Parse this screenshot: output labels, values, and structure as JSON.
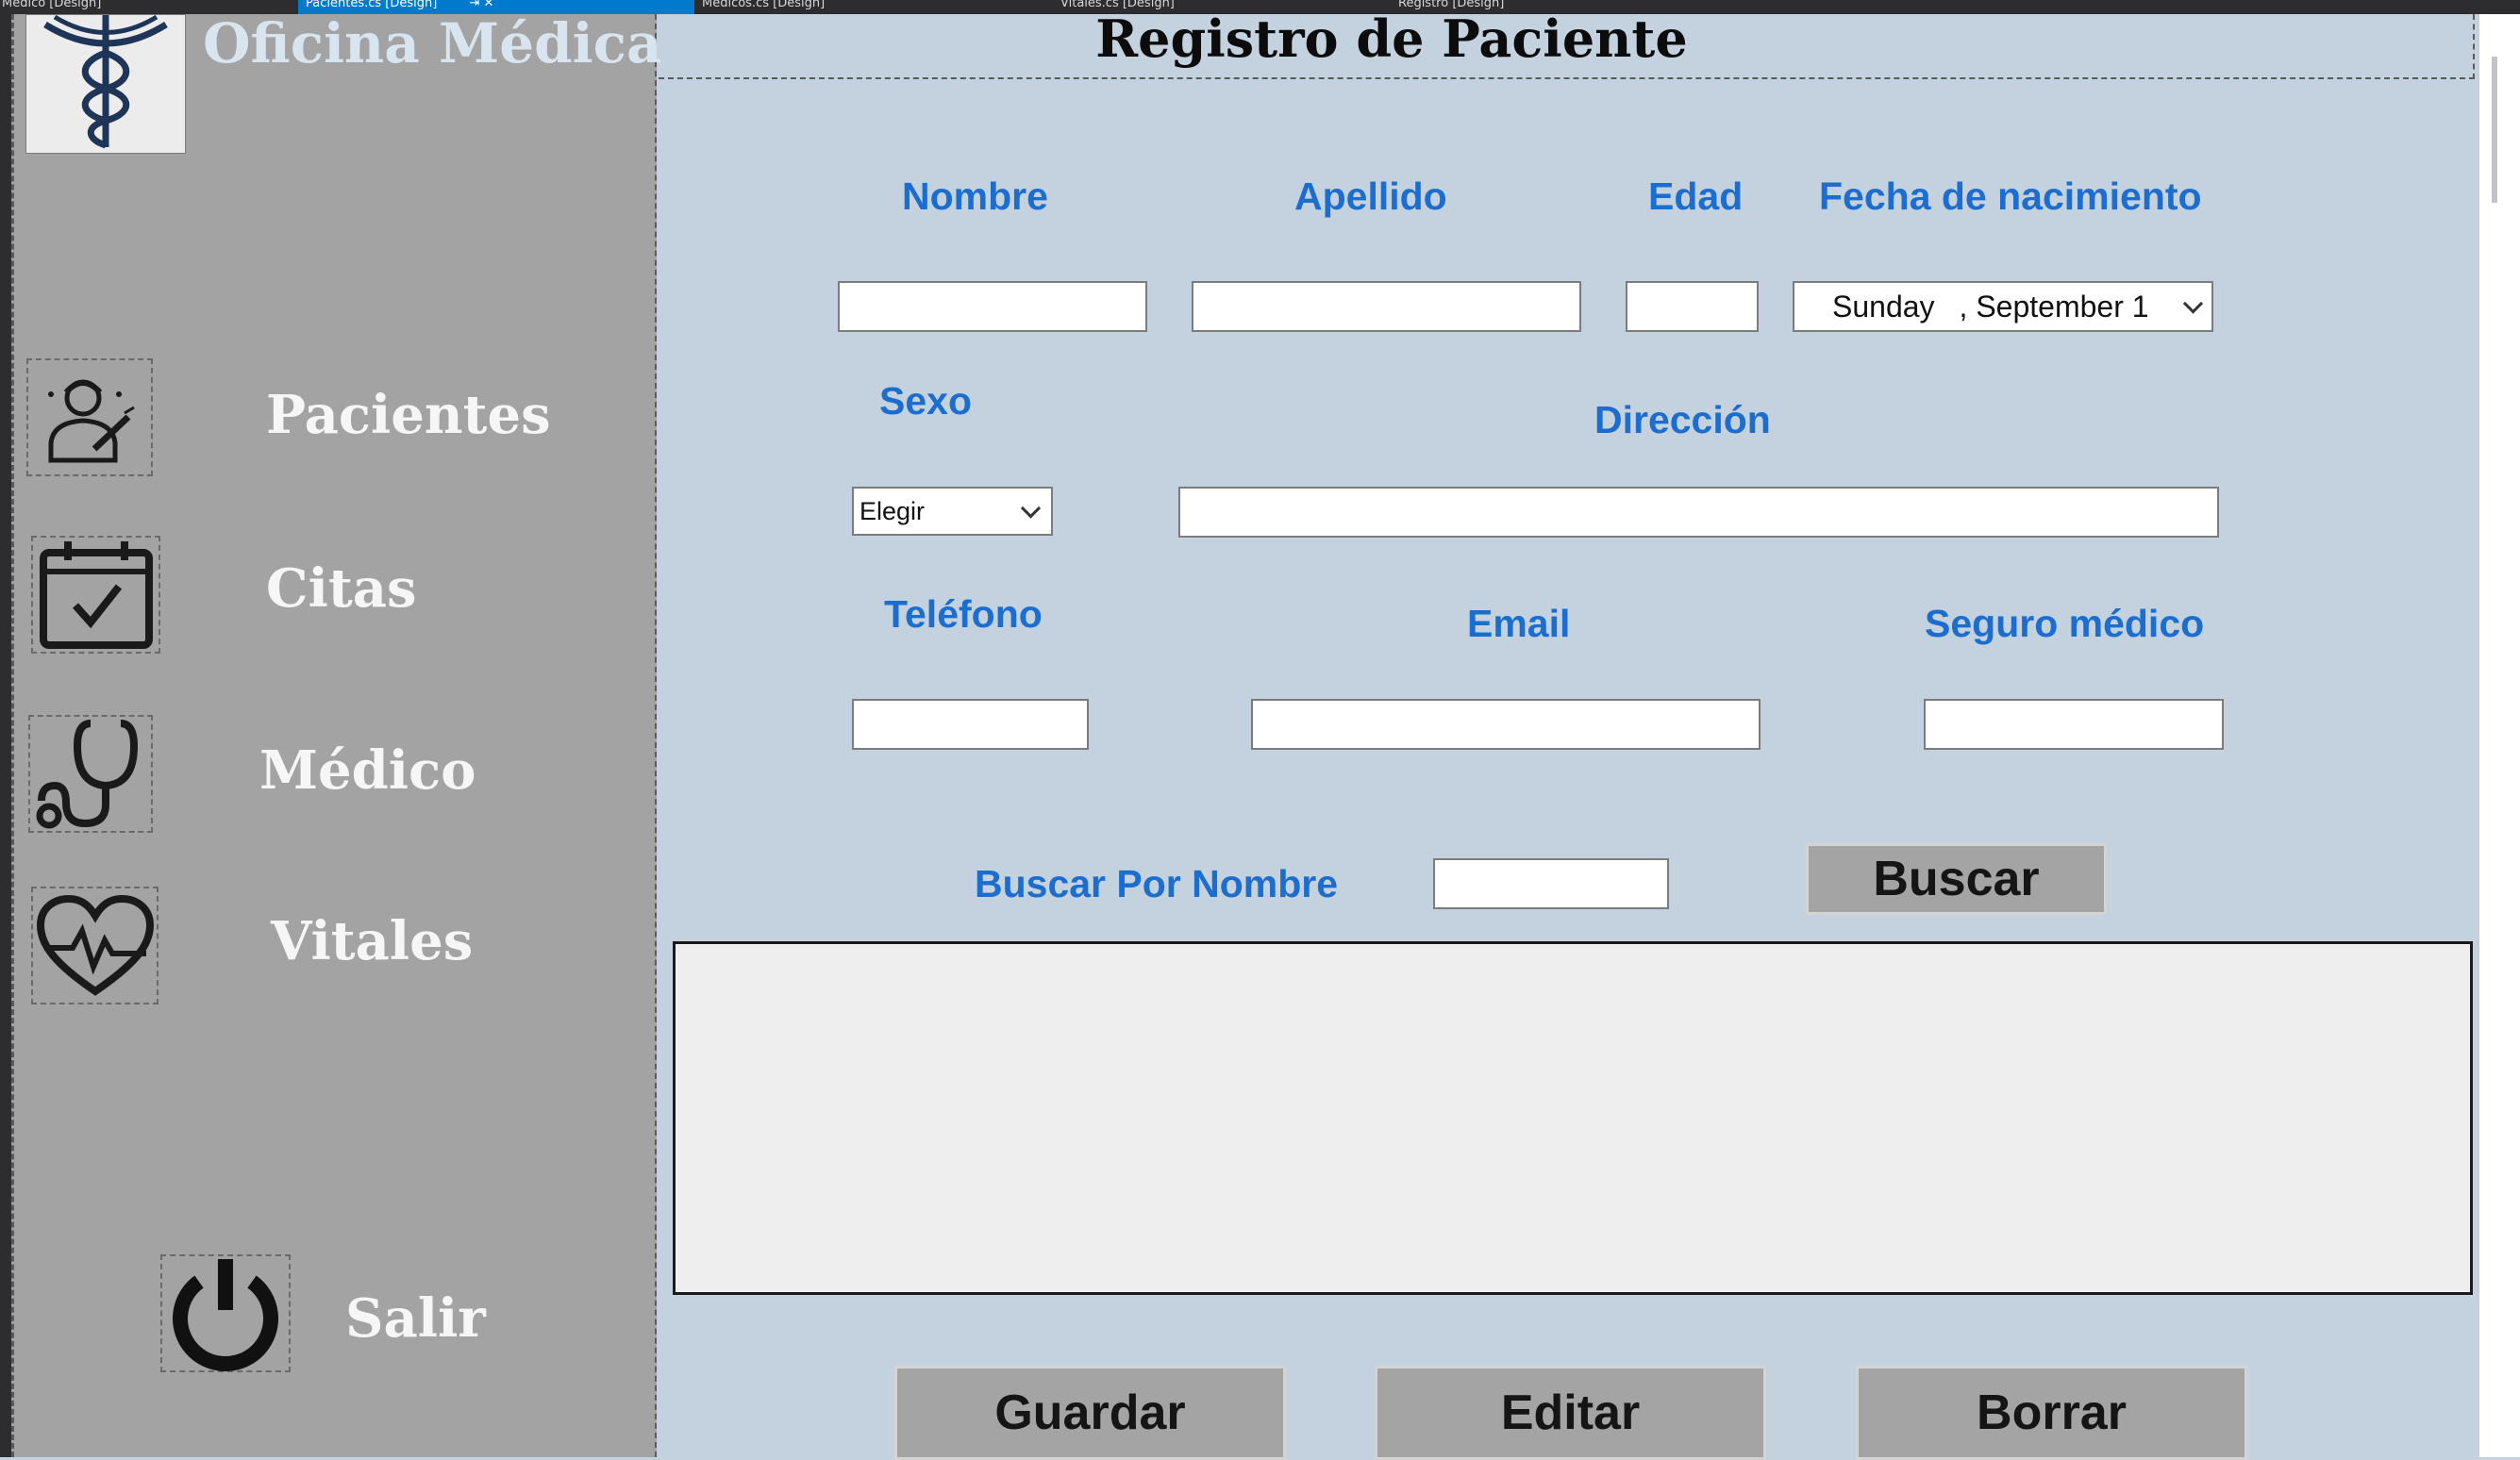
{
  "tabs": [
    {
      "label": "Médico [Design]"
    },
    {
      "label": "Pacientes.cs [Design]",
      "close": "⇥ ✕"
    },
    {
      "label": "Medicos.cs [Design]"
    },
    {
      "label": "Vitales.cs [Design]"
    },
    {
      "label": "Registro [Design]"
    }
  ],
  "sidebar": {
    "app_name": "Oficina Médica",
    "logo_icon": "caduceus-icon",
    "items": [
      {
        "label": "Pacientes",
        "icon": "doctor-icon"
      },
      {
        "label": "Citas",
        "icon": "calendar-check-icon"
      },
      {
        "label": "Médico",
        "icon": "stethoscope-icon"
      },
      {
        "label": "Vitales",
        "icon": "heart-pulse-icon"
      }
    ],
    "exit": {
      "label": "Salir",
      "icon": "power-icon"
    }
  },
  "form": {
    "title": "Registro de Paciente",
    "labels": {
      "nombre": "Nombre",
      "apellido": "Apellido",
      "edad": "Edad",
      "fecha": "Fecha de nacimiento",
      "sexo": "Sexo",
      "direccion": "Dirección",
      "telefono": "Teléfono",
      "email": "Email",
      "seguro": "Seguro médico",
      "buscar_nombre": "Buscar Por Nombre"
    },
    "values": {
      "nombre": "",
      "apellido": "",
      "edad": "",
      "direccion": "",
      "telefono": "",
      "email": "",
      "seguro": "",
      "buscar": ""
    },
    "date": {
      "day": "Sunday",
      "rest": ", September 1"
    },
    "sexo_selected": "Elegir",
    "buttons": {
      "buscar": "Buscar",
      "guardar": "Guardar",
      "editar": "Editar",
      "borrar": "Borrar"
    }
  },
  "colors": {
    "sidebar": "#a3a3a3",
    "form_bg": "#c4d2df",
    "label_blue": "#1b6ed0",
    "button_gray": "#a4a4a4",
    "accent_tab": "#007acc"
  }
}
